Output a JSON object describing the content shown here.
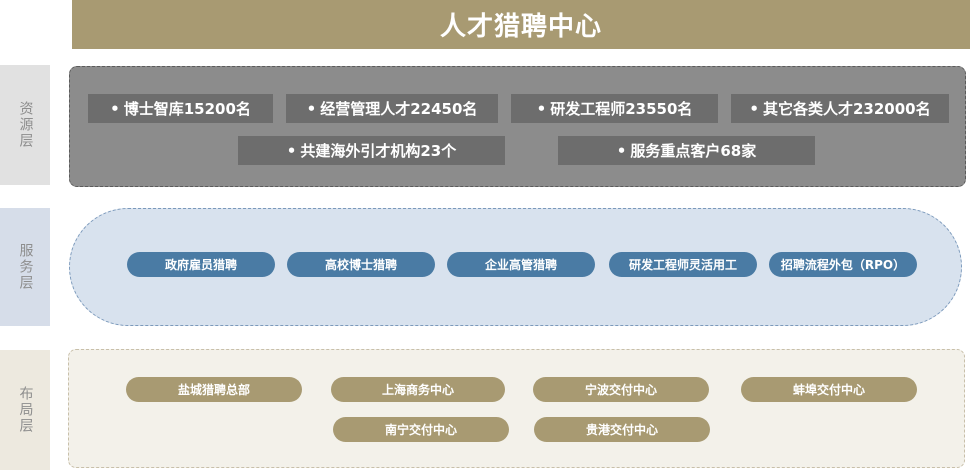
{
  "title": "人才猎聘中心",
  "layers": {
    "resource": {
      "label": "资源层",
      "bullet": "•",
      "items": [
        "博士智库15200名",
        "经营管理人才22450名",
        "研发工程师23550名",
        "其它各类人才232000名",
        "共建海外引才机构23个",
        "服务重点客户68家"
      ]
    },
    "service": {
      "label": "服务层",
      "items": [
        "政府雇员猎聘",
        "高校博士猎聘",
        "企业高管猎聘",
        "研发工程师灵活用工",
        "招聘流程外包（RPO）"
      ]
    },
    "layout": {
      "label": "布局层",
      "items": [
        "盐城猎聘总部",
        "上海商务中心",
        "宁波交付中心",
        "蚌埠交付中心",
        "南宁交付中心",
        "贵港交付中心"
      ]
    }
  },
  "colors": {
    "title_bg": "#a89a72",
    "resource_panel": "#8c8c8c",
    "resource_box": "#6d6d6d",
    "service_panel": "#d8e2ee",
    "service_pill": "#4a7ba4",
    "layout_panel": "#f3f1ea",
    "layout_pill": "#a89a72"
  }
}
